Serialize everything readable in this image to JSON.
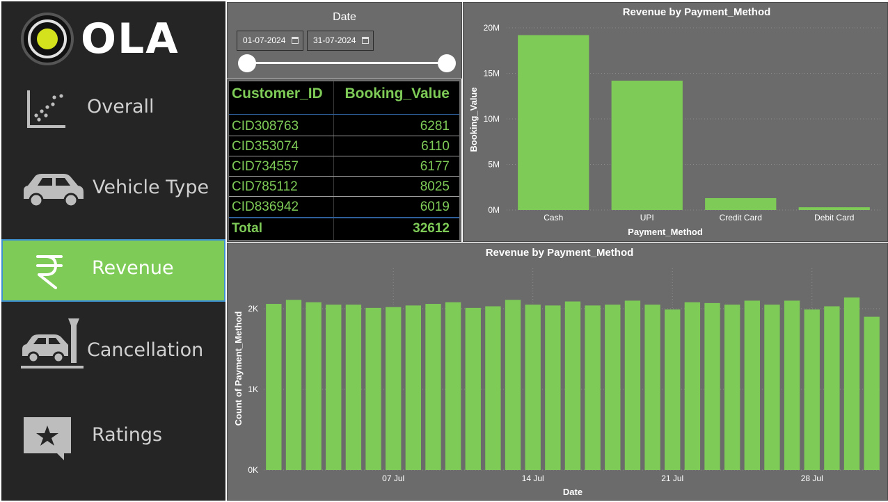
{
  "logo": {
    "text": "OLA"
  },
  "nav": [
    {
      "label": "Overall",
      "icon": "scatter-chart-icon",
      "active": false
    },
    {
      "label": "Vehicle Type",
      "icon": "car-icon",
      "active": false
    },
    {
      "label": "Revenue",
      "icon": "rupee-icon",
      "active": true
    },
    {
      "label": "Cancellation",
      "icon": "car-crash-icon",
      "active": false
    },
    {
      "label": "Ratings",
      "icon": "star-badge-icon",
      "active": false
    }
  ],
  "date_filter": {
    "title": "Date",
    "start": "01-07-2024",
    "end": "31-07-2024"
  },
  "table": {
    "headers": [
      "Customer_ID",
      "Booking_Value"
    ],
    "rows": [
      {
        "id": "CID308763",
        "value": "6281"
      },
      {
        "id": "CID353074",
        "value": "6110"
      },
      {
        "id": "CID734557",
        "value": "6177"
      },
      {
        "id": "CID785112",
        "value": "8025"
      },
      {
        "id": "CID836942",
        "value": "6019"
      }
    ],
    "total_label": "Total",
    "total_value": "32612"
  },
  "colors": {
    "accent": "#7ecb57",
    "sidebar": "#252525",
    "panel": "#6b6b6b"
  },
  "chart_data": [
    {
      "type": "bar",
      "title": "Revenue by Payment_Method",
      "xlabel": "Payment_Method",
      "ylabel": "Booking_Value",
      "categories": [
        "Cash",
        "UPI",
        "Credit Card",
        "Debit Card"
      ],
      "values": [
        19200000,
        14200000,
        1300000,
        300000
      ],
      "ylim": [
        0,
        20000000
      ],
      "yticks": [
        0,
        5000000,
        10000000,
        15000000,
        20000000
      ],
      "ytick_labels": [
        "0M",
        "5M",
        "10M",
        "15M",
        "20M"
      ],
      "grid": true
    },
    {
      "type": "bar",
      "title": "Revenue by Payment_Method",
      "xlabel": "Date",
      "ylabel": "Count of Payment_Method",
      "values": [
        2060,
        2110,
        2080,
        2050,
        2050,
        2010,
        2020,
        2040,
        2060,
        2080,
        2010,
        2030,
        2110,
        2050,
        2040,
        2090,
        2040,
        2050,
        2100,
        2050,
        1990,
        2080,
        2070,
        2050,
        2100,
        2050,
        2100,
        1990,
        2030,
        2140,
        1900
      ],
      "ylim": [
        0,
        2500
      ],
      "yticks": [
        0,
        1000,
        2000
      ],
      "ytick_labels": [
        "0K",
        "1K",
        "2K"
      ],
      "xtick_labels": [
        {
          "index": 6,
          "label": "07 Jul"
        },
        {
          "index": 13,
          "label": "14 Jul"
        },
        {
          "index": 20,
          "label": "21 Jul"
        },
        {
          "index": 27,
          "label": "28 Jul"
        }
      ],
      "grid": true
    }
  ]
}
